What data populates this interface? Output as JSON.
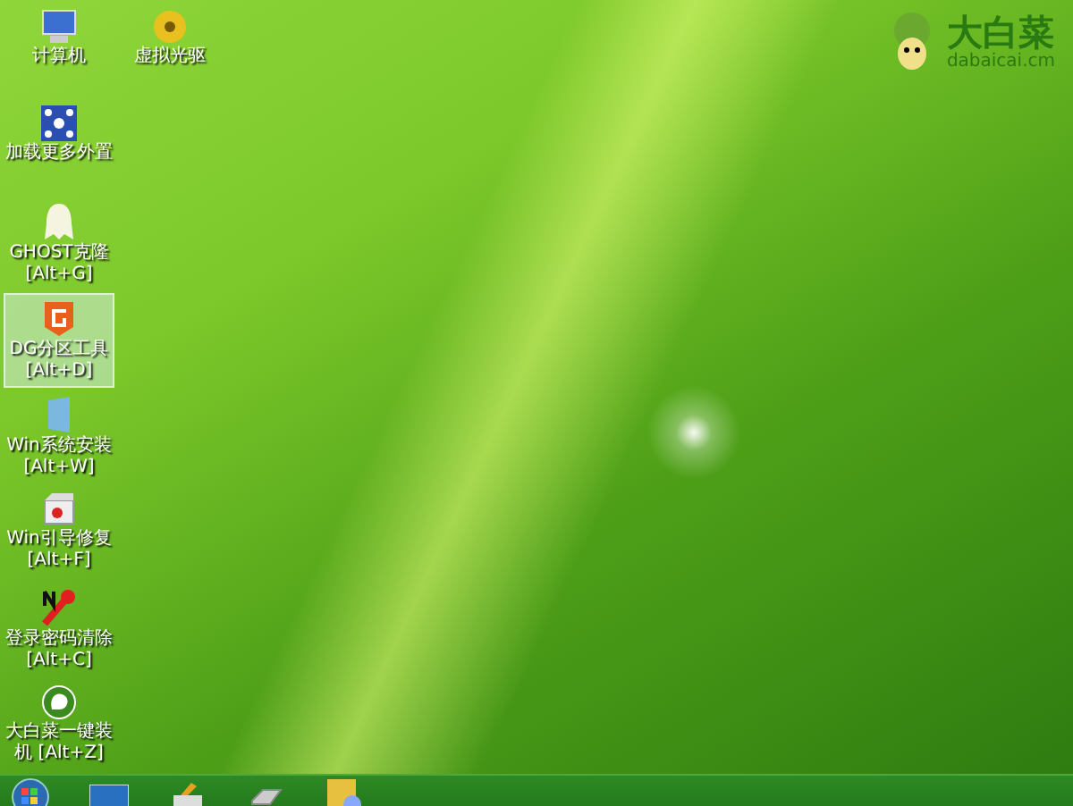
{
  "wallpaper": {
    "logo": {
      "title": "大白菜",
      "subtitle": "dabaicai.cm"
    }
  },
  "desktop_icons": [
    {
      "kind": "computer",
      "label": "计算机",
      "selected": false
    },
    {
      "kind": "disc",
      "label": "虚拟光驱",
      "selected": false
    },
    {
      "kind": "network",
      "label": "加载更多外置",
      "selected": false
    },
    {
      "kind": "ghost",
      "label": "GHOST克隆",
      "shortcut": "[Alt+G]",
      "selected": false
    },
    {
      "kind": "partition",
      "label": "DG分区工具",
      "shortcut": "[Alt+D]",
      "selected": true
    },
    {
      "kind": "install",
      "label": "Win系统安装",
      "shortcut": "[Alt+W]",
      "selected": false
    },
    {
      "kind": "repair",
      "label": "Win引导修复",
      "shortcut": "[Alt+F]",
      "selected": false
    },
    {
      "kind": "password",
      "label": "登录密码清除",
      "shortcut": "[Alt+C]",
      "selected": false
    },
    {
      "kind": "cabbage",
      "label": "大白菜一键装",
      "shortcut": "机 [Alt+Z]",
      "selected": false
    }
  ],
  "taskbar": {
    "items": [
      {
        "kind": "start"
      },
      {
        "kind": "monitor"
      },
      {
        "kind": "printer"
      },
      {
        "kind": "drive"
      },
      {
        "kind": "paint"
      }
    ]
  }
}
